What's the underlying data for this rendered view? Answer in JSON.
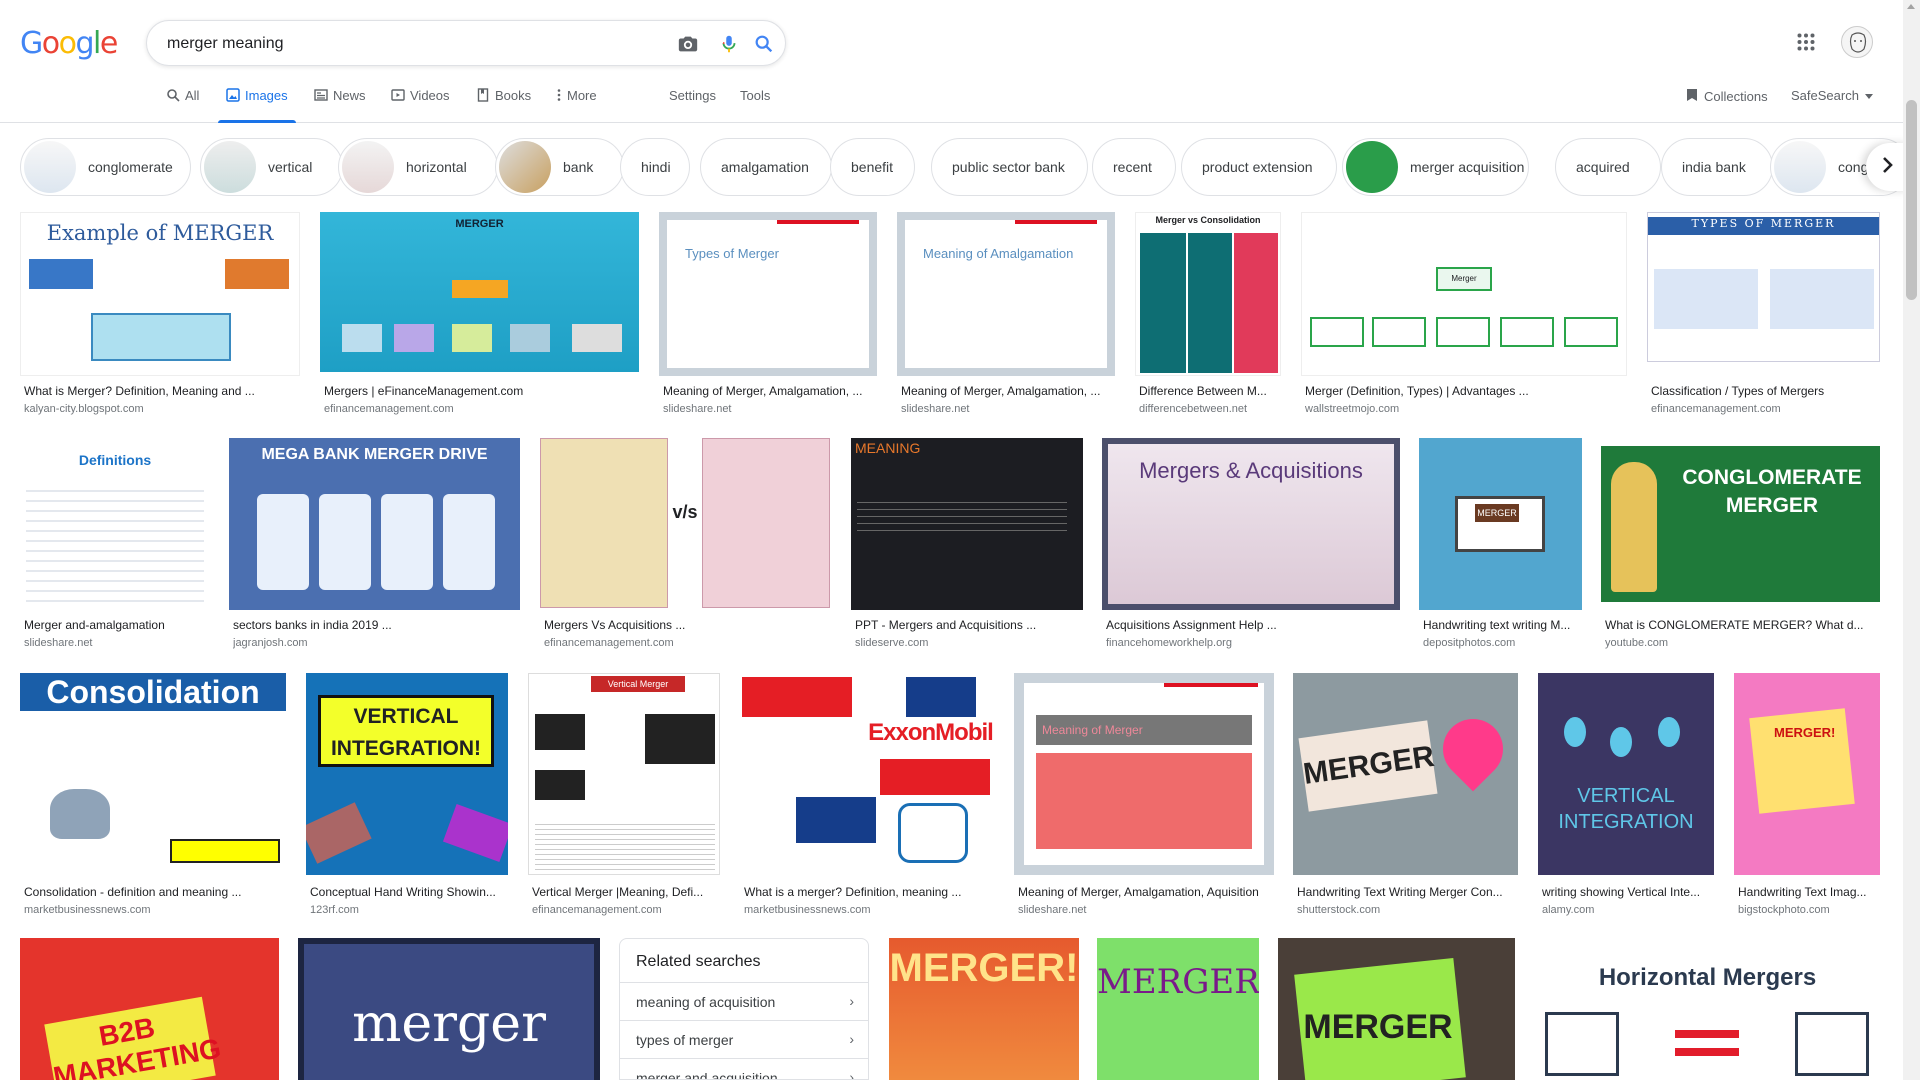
{
  "header": {
    "logo": "Google",
    "search_value": "merger meaning",
    "icons": [
      "camera-icon",
      "mic-icon",
      "search-icon",
      "apps-icon",
      "avatar"
    ]
  },
  "tabs": [
    {
      "label": "All",
      "icon": "search-icon"
    },
    {
      "label": "Images",
      "icon": "image-icon",
      "active": true
    },
    {
      "label": "News",
      "icon": "news-icon"
    },
    {
      "label": "Videos",
      "icon": "video-icon"
    },
    {
      "label": "Books",
      "icon": "book-icon"
    },
    {
      "label": "More",
      "icon": "more-vert-icon"
    }
  ],
  "tools": {
    "settings": "Settings",
    "tools": "Tools",
    "collections": "Collections",
    "safesearch": "SafeSearch"
  },
  "chips": [
    "conglomerate",
    "vertical",
    "horizontal",
    "bank",
    "hindi",
    "amalgamation",
    "benefit",
    "public sector bank",
    "recent",
    "product extension",
    "merger acquisition",
    "acquired",
    "india bank",
    "cong"
  ],
  "results": [
    {
      "caption": "What is Merger? Definition, Meaning and ...",
      "source": "kalyan-city.blogspot.com",
      "thumb_title": "Example of MERGER"
    },
    {
      "caption": "Mergers | eFinanceManagement.com",
      "source": "efinancemanagement.com",
      "thumb_title": "MERGER"
    },
    {
      "caption": "Meaning of Merger, Amalgamation, ...",
      "source": "slideshare.net",
      "thumb_title": "Types of Merger"
    },
    {
      "caption": "Meaning of Merger, Amalgamation, ...",
      "source": "slideshare.net",
      "thumb_title": "Meaning of Amalgamation"
    },
    {
      "caption": "Difference Between M...",
      "source": "differencebetween.net",
      "thumb_title": "Merger vs Consolidation"
    },
    {
      "caption": "Merger (Definition, Types) | Advantages ...",
      "source": "wallstreetmojo.com",
      "thumb_title": "Merger"
    },
    {
      "caption": "Classification / Types of Mergers",
      "source": "efinancemanagement.com",
      "thumb_title": "TYPES OF MERGER"
    },
    {
      "caption": "Merger and-amalgamation",
      "source": "slideshare.net",
      "thumb_title": "Definitions"
    },
    {
      "caption": "sectors banks in india 2019 ...",
      "source": "jagranjosh.com",
      "thumb_title": "MEGA BANK MERGER DRIVE"
    },
    {
      "caption": "Mergers Vs Acquisitions ...",
      "source": "efinancemanagement.com",
      "thumb_title": "v/s"
    },
    {
      "caption": "PPT - Mergers and Acquisitions ...",
      "source": "slideserve.com",
      "thumb_title": "MEANING"
    },
    {
      "caption": "Acquisitions Assignment Help ...",
      "source": "financehomeworkhelp.org",
      "thumb_title": "Mergers & Acquisitions"
    },
    {
      "caption": "Handwriting text writing M...",
      "source": "depositphotos.com",
      "thumb_title": "MERGER"
    },
    {
      "caption": "What is CONGLOMERATE MERGER? What d...",
      "source": "youtube.com",
      "thumb_title": "CONGLOMERATE MERGER"
    },
    {
      "caption": "Consolidation - definition and meaning ...",
      "source": "marketbusinessnews.com",
      "thumb_title": "Consolidation"
    },
    {
      "caption": "Conceptual Hand Writing Showin...",
      "source": "123rf.com",
      "thumb_title": "VERTICAL INTEGRATION!"
    },
    {
      "caption": "Vertical Merger |Meaning, Defi...",
      "source": "efinancemanagement.com",
      "thumb_title": "Vertical Merger"
    },
    {
      "caption": "What is a merger? Definition, meaning ...",
      "source": "marketbusinessnews.com",
      "thumb_title": "ExxonMobil"
    },
    {
      "caption": "Meaning of Merger, Amalgamation, Aquisition",
      "source": "slideshare.net",
      "thumb_title": "Meaning of Merger"
    },
    {
      "caption": "Handwriting Text Writing Merger Con...",
      "source": "shutterstock.com",
      "thumb_title": "MERGER"
    },
    {
      "caption": "writing showing Vertical Inte...",
      "source": "alamy.com",
      "thumb_title": "VERTICAL INTEGRATION"
    },
    {
      "caption": "Handwriting Text Imag...",
      "source": "bigstockphoto.com",
      "thumb_title": "MERGER!"
    },
    {
      "caption": "",
      "source": "",
      "thumb_title": "B2B MARKETING"
    },
    {
      "caption": "",
      "source": "",
      "thumb_title": "merger"
    },
    {
      "caption": "",
      "source": "",
      "thumb_title": "MERGER!"
    },
    {
      "caption": "",
      "source": "",
      "thumb_title": "MERGER!"
    },
    {
      "caption": "",
      "source": "",
      "thumb_title": "MERGER"
    },
    {
      "caption": "",
      "source": "",
      "thumb_title": "Horizontal Mergers"
    }
  ],
  "related": {
    "title": "Related searches",
    "items": [
      "meaning of acquisition",
      "types of merger",
      "merger and acquisition"
    ]
  },
  "colors": {
    "accent": "#1a73e8",
    "border": "#dfe1e5",
    "text": "#202124",
    "muted": "#70757a"
  }
}
